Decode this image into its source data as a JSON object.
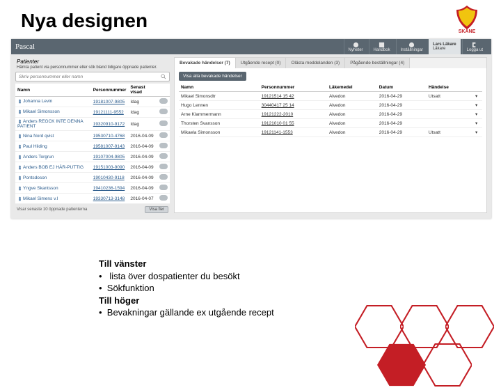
{
  "slide": {
    "title": "Nya designen"
  },
  "logo_label": "SKÅNE",
  "app": {
    "title": "Pascal",
    "nav": {
      "n1": "Nyheter",
      "n2": "Handbok",
      "n3": "Inställningar",
      "n4": "Logga ut"
    },
    "user": {
      "name": "Lars Läkare",
      "role": "Läkare"
    }
  },
  "left": {
    "heading": "Patienter",
    "sub": "Hämta patient via personnummer eller sök bland tidigare öppnade patienter.",
    "placeholder": "Skriv personnummer eller namn",
    "cols": {
      "c1": "Namn",
      "c2": "Personnummer",
      "c3": "Senast visad",
      "c4": ""
    },
    "rows": [
      {
        "n": "Johanna Levin",
        "p": "19181007-9805",
        "d": "Idag"
      },
      {
        "n": "Mikael Simonsson",
        "p": "19121111-9552",
        "d": "Idag"
      },
      {
        "n": "Anders REGCK INTE DENNA PATIENT",
        "p": "19320910-9172",
        "d": "Idag"
      },
      {
        "n": "Nina Nord qvist",
        "p": "19530710-4768",
        "d": "2016-04-09"
      },
      {
        "n": "Paul Hilding",
        "p": "19581007-9143",
        "d": "2016-04-09"
      },
      {
        "n": "Anders Torgrun",
        "p": "19107004-9805",
        "d": "2016-04-09"
      },
      {
        "n": "Anders BOB EJ HÄR-PUTTIG",
        "p": "19151003-9090",
        "d": "2016-04-09"
      },
      {
        "n": "Pontsdoson",
        "p": "19010430-9118",
        "d": "2016-04-09"
      },
      {
        "n": "Yngve Skantsson",
        "p": "19410236-1594",
        "d": "2016-04-09"
      },
      {
        "n": "Mikael Simens v.l",
        "p": "19330713-3148",
        "d": "2016-04-07"
      }
    ],
    "footer_text": "Visar senaste 10 öppnade patienterna",
    "footer_btn": "Visa fler"
  },
  "right": {
    "tabs": {
      "t1": "Bevakade händelser (7)",
      "t2": "Utgående recept (0)",
      "t3": "Olästa meddelanden (3)",
      "t4": "Pågående beställningar (4)"
    },
    "btn": "Visa alla bevakade händelser",
    "cols": {
      "c1": "Namn",
      "c2": "Personnummer",
      "c3": "Läkemedel",
      "c4": "Datum",
      "c5": "Händelse"
    },
    "rows": [
      {
        "n": "Mikael Simonsdtr",
        "p": "19121514 15 42",
        "l": "Alvedon",
        "d": "2016-04-29",
        "h": "Utsatt"
      },
      {
        "n": "Hugo Lennen",
        "p": "30440417 25 14",
        "l": "Alvedon",
        "d": "2016-04-29",
        "h": ""
      },
      {
        "n": "Arne Klammermann",
        "p": "19121222-2010",
        "l": "Alvedon",
        "d": "2016-04-29",
        "h": ""
      },
      {
        "n": "Thorsten Svansson",
        "p": "19121010 01 55",
        "l": "Alvedon",
        "d": "2016-04-29",
        "h": ""
      },
      {
        "n": "Mikaela Simonsson",
        "p": "19121141-1553",
        "l": "Alvedon",
        "d": "2016-04-29",
        "h": "Utsatt"
      }
    ]
  },
  "bullets": {
    "h1": "Till vänster",
    "b1": " lista över dospatienter du besökt",
    "b2": "Sökfunktion",
    "h2": "Till höger",
    "b3": "Bevakningar gällande ex utgående recept"
  }
}
